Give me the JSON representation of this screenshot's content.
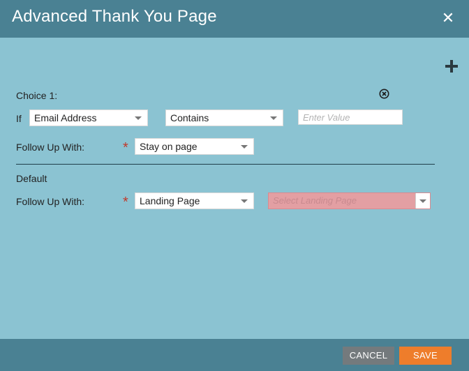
{
  "dialog": {
    "title": "Advanced Thank You Page",
    "close_icon": "close-icon",
    "add_icon": "plus-icon"
  },
  "choice1": {
    "label": "Choice 1:",
    "remove_icon": "remove-circle-icon",
    "if_label": "If",
    "field_select": "Email Address",
    "operator_select": "Contains",
    "value_placeholder": "Enter Value",
    "follow_up_label": "Follow Up With:",
    "follow_up_select": "Stay on page"
  },
  "default": {
    "label": "Default",
    "follow_up_label": "Follow Up With:",
    "follow_up_select": "Landing Page",
    "landing_page_placeholder": "Select Landing Page"
  },
  "footer": {
    "cancel_label": "CANCEL",
    "save_label": "SAVE"
  },
  "colors": {
    "header": "#4a8193",
    "body": "#8bc3d2",
    "save": "#ee7d2b",
    "cancel": "#747a7d",
    "required": "#c0392b",
    "invalid_field": "#e39fa3"
  }
}
